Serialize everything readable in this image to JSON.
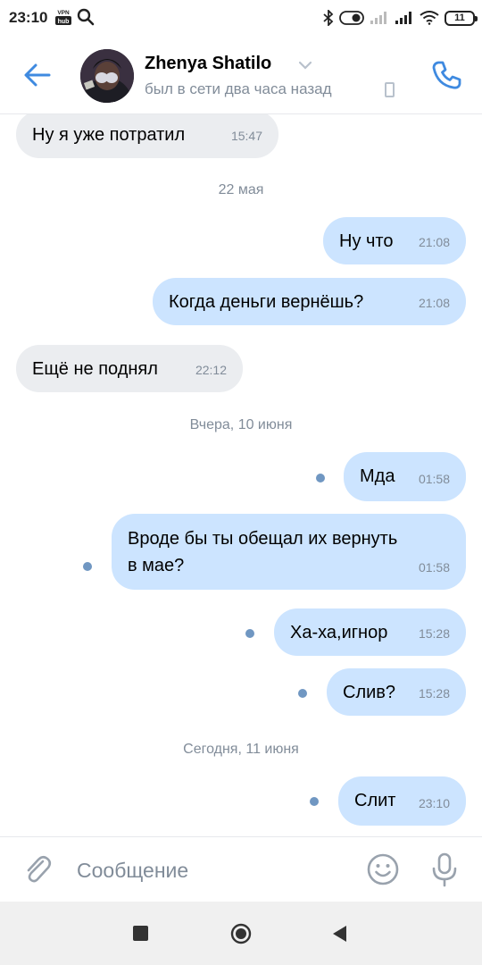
{
  "status_bar": {
    "time": "23:10",
    "vpn_text": "VPN hub",
    "battery": "11",
    "icons": [
      "vpn-hub-icon",
      "search-icon",
      "bluetooth-icon",
      "toggle-icon",
      "signal-icon",
      "signal-icon",
      "wifi-icon",
      "battery-icon"
    ]
  },
  "header": {
    "back_icon": "arrow-left-icon",
    "contact_name": "Zhenya Shatilo",
    "status": "был в сети два часа назад",
    "call_icon": "phone-icon",
    "accent_color": "#3f8ae0"
  },
  "messages": [
    {
      "kind": "message",
      "dir": "in",
      "text": "Ну я уже потратил",
      "time": "15:47"
    },
    {
      "kind": "date",
      "text": "22 мая"
    },
    {
      "kind": "message",
      "dir": "out",
      "text": "Ну что",
      "time": "21:08"
    },
    {
      "kind": "message",
      "dir": "out",
      "text": "Когда деньги вернёшь?",
      "time": "21:08"
    },
    {
      "kind": "message",
      "dir": "in",
      "text": "Ещё не поднял",
      "time": "22:12"
    },
    {
      "kind": "date",
      "text": "Вчера, 10 июня"
    },
    {
      "kind": "message",
      "dir": "out",
      "text": "Мда",
      "time": "01:58",
      "unread": true
    },
    {
      "kind": "message",
      "dir": "out",
      "text_line1": "Вроде бы ты обещал их вернуть",
      "text_line2": "в мае?",
      "time": "01:58",
      "unread": true
    },
    {
      "kind": "message",
      "dir": "out",
      "text": "Ха-ха,игнор",
      "time": "15:28",
      "unread": true
    },
    {
      "kind": "message",
      "dir": "out",
      "text": "Слив?",
      "time": "15:28",
      "unread": true
    },
    {
      "kind": "date",
      "text": "Сегодня, 11 июня"
    },
    {
      "kind": "message",
      "dir": "out",
      "text": "Слит",
      "time": "23:10",
      "unread": true
    }
  ],
  "composer": {
    "placeholder": "Сообщение",
    "icons": [
      "paperclip-icon",
      "emoji-icon",
      "microphone-icon"
    ]
  },
  "colors": {
    "incoming_bubble": "#ebedf0",
    "outgoing_bubble": "#cce4ff",
    "unread_dot": "#7097c2",
    "secondary_text": "#818c99"
  }
}
